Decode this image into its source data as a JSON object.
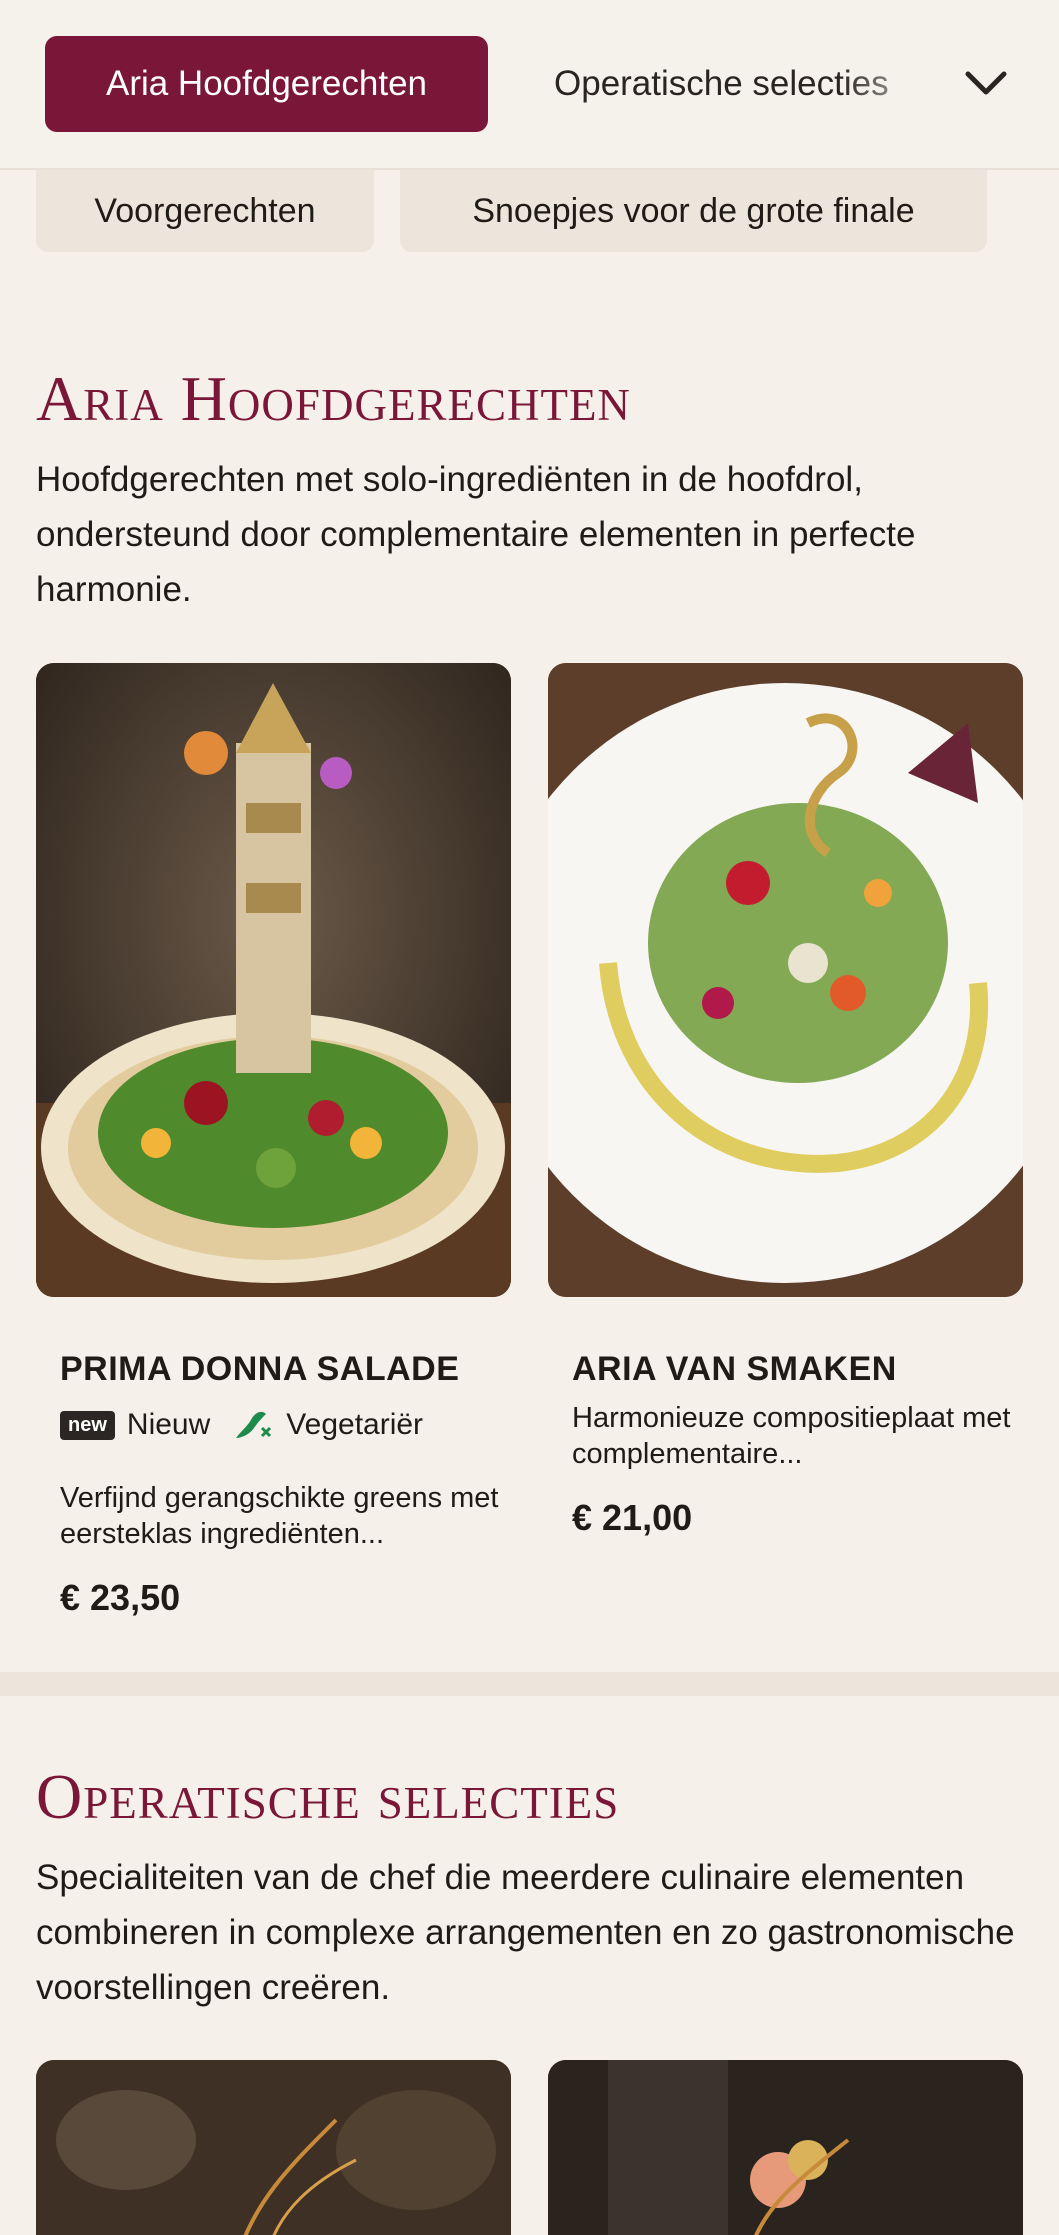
{
  "nav": {
    "active_category": "Aria Hoofdgerechten",
    "next_category": "Operatische selecties",
    "sub_categories": [
      "Voorgerechten",
      "Snoepjes voor de grote finale"
    ]
  },
  "sections": [
    {
      "title": "Aria Hoofdgerechten",
      "description": "Hoofdgerechten met solo-ingrediënten in de hoofdrol, ondersteund door complementaire elementen in perfecte harmonie.",
      "items": [
        {
          "name": "PRIMA DONNA SALADE",
          "badge": "new",
          "tag_new": "Nieuw",
          "tag_veg": "Vegetariër",
          "description": "Verfijnd gerangschikte greens met eersteklas ingrediënten...",
          "price": "€ 23,50"
        },
        {
          "name": "ARIA VAN SMAKEN",
          "description": "Harmonieuze compositieplaat met complementaire...",
          "price": "€ 21,00"
        }
      ]
    },
    {
      "title": "Operatische selecties",
      "description": "Specialiteiten van de chef die meerdere culinaire elementen combineren in complexe arrangementen en zo gastronomische voorstellingen creëren."
    }
  ],
  "colors": {
    "accent": "#7a1638",
    "background": "#f5f1ea",
    "veg_green": "#1e8a4c"
  }
}
